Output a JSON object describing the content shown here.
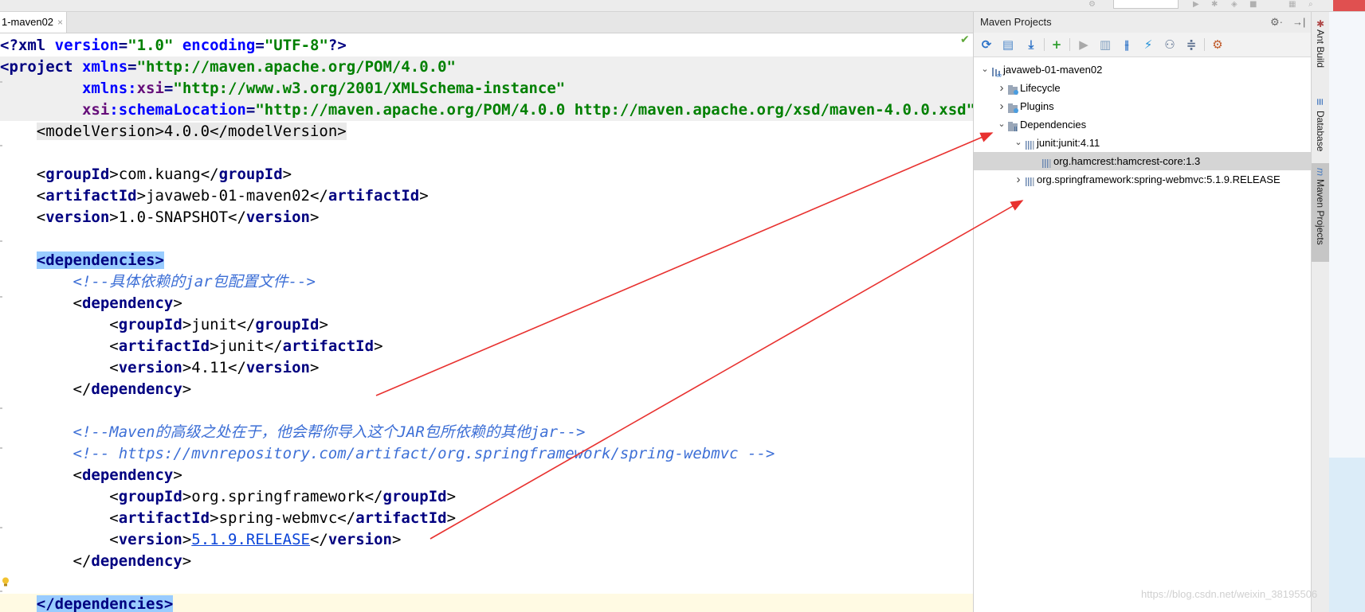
{
  "top_strip": {
    "icons": [
      "run-icon",
      "debug-icon",
      "profile-icon",
      "stop-icon",
      "layout-icon",
      "search-icon"
    ]
  },
  "editor": {
    "tab_label": "1-maven02",
    "tab_close": "×",
    "lines": [
      {
        "parts": [
          {
            "k": "t",
            "v": "<?"
          },
          {
            "k": "t",
            "v": "xml "
          },
          {
            "k": "a",
            "v": "version"
          },
          {
            "k": "t",
            "v": "="
          },
          {
            "k": "s",
            "v": "\"1.0\""
          },
          {
            "k": "t",
            "v": " "
          },
          {
            "k": "a",
            "v": "encoding"
          },
          {
            "k": "t",
            "v": "="
          },
          {
            "k": "s",
            "v": "\"UTF-8\""
          },
          {
            "k": "t",
            "v": "?>"
          }
        ]
      },
      {
        "hl": true,
        "parts": [
          {
            "k": "t",
            "v": "<project "
          },
          {
            "k": "a",
            "v": "xmlns"
          },
          {
            "k": "t",
            "v": "="
          },
          {
            "k": "s",
            "v": "\"http://maven.apache.org/POM/4.0.0\""
          }
        ]
      },
      {
        "hl": true,
        "parts": [
          {
            "k": "p",
            "v": "         "
          },
          {
            "k": "a",
            "v": "xmlns:"
          },
          {
            "k": "n",
            "v": "xsi"
          },
          {
            "k": "t",
            "v": "="
          },
          {
            "k": "s",
            "v": "\"http://www.w3.org/2001/XMLSchema-instance\""
          }
        ]
      },
      {
        "hl": true,
        "parts": [
          {
            "k": "p",
            "v": "         "
          },
          {
            "k": "n",
            "v": "xsi"
          },
          {
            "k": "a",
            "v": ":schemaLocation"
          },
          {
            "k": "t",
            "v": "="
          },
          {
            "k": "s",
            "v": "\"http://maven.apache.org/POM/4.0.0 http://maven.apache.org/xsd/maven-4.0.0.xsd\""
          }
        ]
      },
      {
        "parts": [
          {
            "k": "p",
            "v": "    "
          },
          {
            "k": "g",
            "v": "<modelVersion>4.0.0</modelVersion>"
          }
        ]
      },
      {
        "parts": []
      },
      {
        "parts": [
          {
            "k": "p",
            "v": "    "
          },
          {
            "k": "gt",
            "v": "<"
          },
          {
            "k": "tg",
            "v": "groupId"
          },
          {
            "k": "gt",
            "v": ">"
          },
          {
            "k": "p",
            "v": "com.kuang"
          },
          {
            "k": "gt",
            "v": "</"
          },
          {
            "k": "tg",
            "v": "groupId"
          },
          {
            "k": "gt",
            "v": ">"
          }
        ]
      },
      {
        "parts": [
          {
            "k": "p",
            "v": "    "
          },
          {
            "k": "gt",
            "v": "<"
          },
          {
            "k": "tg",
            "v": "artifactId"
          },
          {
            "k": "gt",
            "v": ">"
          },
          {
            "k": "p",
            "v": "javaweb-01-maven02"
          },
          {
            "k": "gt",
            "v": "</"
          },
          {
            "k": "tg",
            "v": "artifactId"
          },
          {
            "k": "gt",
            "v": ">"
          }
        ]
      },
      {
        "parts": [
          {
            "k": "p",
            "v": "    "
          },
          {
            "k": "gt",
            "v": "<"
          },
          {
            "k": "tg",
            "v": "version"
          },
          {
            "k": "gt",
            "v": ">"
          },
          {
            "k": "p",
            "v": "1.0-SNAPSHOT"
          },
          {
            "k": "gt",
            "v": "</"
          },
          {
            "k": "tg",
            "v": "version"
          },
          {
            "k": "gt",
            "v": ">"
          }
        ]
      },
      {
        "parts": []
      },
      {
        "parts": [
          {
            "k": "p",
            "v": "    "
          },
          {
            "k": "bm",
            "v": "<dependencies>"
          }
        ]
      },
      {
        "parts": [
          {
            "k": "p",
            "v": "        "
          },
          {
            "k": "c",
            "v": "<!--具体依赖的jar包配置文件-->"
          }
        ]
      },
      {
        "parts": [
          {
            "k": "p",
            "v": "        "
          },
          {
            "k": "gt",
            "v": "<"
          },
          {
            "k": "tg",
            "v": "dependency"
          },
          {
            "k": "gt",
            "v": ">"
          }
        ]
      },
      {
        "parts": [
          {
            "k": "p",
            "v": "            "
          },
          {
            "k": "gt",
            "v": "<"
          },
          {
            "k": "tg",
            "v": "groupId"
          },
          {
            "k": "gt",
            "v": ">"
          },
          {
            "k": "p",
            "v": "junit"
          },
          {
            "k": "gt",
            "v": "</"
          },
          {
            "k": "tg",
            "v": "groupId"
          },
          {
            "k": "gt",
            "v": ">"
          }
        ]
      },
      {
        "parts": [
          {
            "k": "p",
            "v": "            "
          },
          {
            "k": "gt",
            "v": "<"
          },
          {
            "k": "tg",
            "v": "artifactId"
          },
          {
            "k": "gt",
            "v": ">"
          },
          {
            "k": "p",
            "v": "junit"
          },
          {
            "k": "gt",
            "v": "</"
          },
          {
            "k": "tg",
            "v": "artifactId"
          },
          {
            "k": "gt",
            "v": ">"
          }
        ]
      },
      {
        "parts": [
          {
            "k": "p",
            "v": "            "
          },
          {
            "k": "gt",
            "v": "<"
          },
          {
            "k": "tg",
            "v": "version"
          },
          {
            "k": "gt",
            "v": ">"
          },
          {
            "k": "p",
            "v": "4.11"
          },
          {
            "k": "gt",
            "v": "</"
          },
          {
            "k": "tg",
            "v": "version"
          },
          {
            "k": "gt",
            "v": ">"
          }
        ]
      },
      {
        "parts": [
          {
            "k": "p",
            "v": "        "
          },
          {
            "k": "gt",
            "v": "</"
          },
          {
            "k": "tg",
            "v": "dependency"
          },
          {
            "k": "gt",
            "v": ">"
          }
        ]
      },
      {
        "parts": []
      },
      {
        "parts": [
          {
            "k": "p",
            "v": "        "
          },
          {
            "k": "c",
            "v": "<!--Maven的高级之处在于，他会帮你导入这个JAR包所依赖的其他jar-->"
          }
        ]
      },
      {
        "parts": [
          {
            "k": "p",
            "v": "        "
          },
          {
            "k": "c",
            "v": "<!-- https://mvnrepository.com/artifact/org.springframework/spring-webmvc -->"
          }
        ]
      },
      {
        "parts": [
          {
            "k": "p",
            "v": "        "
          },
          {
            "k": "gt",
            "v": "<"
          },
          {
            "k": "tg",
            "v": "dependency"
          },
          {
            "k": "gt",
            "v": ">"
          }
        ]
      },
      {
        "parts": [
          {
            "k": "p",
            "v": "            "
          },
          {
            "k": "gt",
            "v": "<"
          },
          {
            "k": "tg",
            "v": "groupId"
          },
          {
            "k": "gt",
            "v": ">"
          },
          {
            "k": "p",
            "v": "org.springframework"
          },
          {
            "k": "gt",
            "v": "</"
          },
          {
            "k": "tg",
            "v": "groupId"
          },
          {
            "k": "gt",
            "v": ">"
          }
        ]
      },
      {
        "parts": [
          {
            "k": "p",
            "v": "            "
          },
          {
            "k": "gt",
            "v": "<"
          },
          {
            "k": "tg",
            "v": "artifactId"
          },
          {
            "k": "gt",
            "v": ">"
          },
          {
            "k": "p",
            "v": "spring-webmvc"
          },
          {
            "k": "gt",
            "v": "</"
          },
          {
            "k": "tg",
            "v": "artifactId"
          },
          {
            "k": "gt",
            "v": ">"
          }
        ]
      },
      {
        "parts": [
          {
            "k": "p",
            "v": "            "
          },
          {
            "k": "gt",
            "v": "<"
          },
          {
            "k": "tg",
            "v": "version"
          },
          {
            "k": "gt",
            "v": ">"
          },
          {
            "k": "lnk",
            "v": "5.1.9.RELEASE"
          },
          {
            "k": "gt",
            "v": "</"
          },
          {
            "k": "tg",
            "v": "version"
          },
          {
            "k": "gt",
            "v": ">"
          }
        ]
      },
      {
        "parts": [
          {
            "k": "p",
            "v": "        "
          },
          {
            "k": "gt",
            "v": "</"
          },
          {
            "k": "tg",
            "v": "dependency"
          },
          {
            "k": "gt",
            "v": ">"
          }
        ]
      },
      {
        "parts": []
      },
      {
        "caret": true,
        "parts": [
          {
            "k": "p",
            "v": "    "
          },
          {
            "k": "bm",
            "v": "</dependencies>"
          }
        ]
      }
    ]
  },
  "maven": {
    "title": "Maven Projects",
    "settings": "⚙·",
    "hide": "→|",
    "toolbar": [
      "reimport-icon",
      "generate-sources-icon",
      "download-icon",
      "add-icon",
      "run-icon",
      "execute-goal-icon",
      "toggle-offline-icon",
      "skip-tests-icon",
      "show-dependencies-icon",
      "collapse-all-icon",
      "settings-icon"
    ],
    "tree": [
      {
        "label": "javaweb-01-maven02",
        "depth": 0,
        "expand": "open",
        "icon": "maven-module-icon"
      },
      {
        "label": "Lifecycle",
        "depth": 1,
        "expand": "closed",
        "icon": "folder-gear-icon"
      },
      {
        "label": "Plugins",
        "depth": 1,
        "expand": "closed",
        "icon": "folder-gear-icon"
      },
      {
        "label": "Dependencies",
        "depth": 1,
        "expand": "open",
        "icon": "folder-library-icon"
      },
      {
        "label": "junit:junit:4.11",
        "depth": 2,
        "expand": "open",
        "icon": "library-icon"
      },
      {
        "label": "org.hamcrest:hamcrest-core:1.3",
        "depth": 3,
        "expand": "none",
        "icon": "library-icon",
        "selected": true
      },
      {
        "label": "org.springframework:spring-webmvc:5.1.9.RELEASE",
        "depth": 2,
        "expand": "closed",
        "icon": "library-icon"
      }
    ]
  },
  "right_strip": {
    "tabs": [
      {
        "label": "Ant Build",
        "icon": "ant-icon"
      },
      {
        "label": "Database",
        "icon": "database-icon"
      },
      {
        "label": "Maven Projects",
        "icon": "maven-icon",
        "active": true
      }
    ]
  },
  "watermark": "https://blog.csdn.net/weixin_38195506",
  "colors": {
    "tag": "#000080",
    "attr": "#0000ff",
    "string": "#008000",
    "comment": "#3d6fd6",
    "arrow": "#e8312f",
    "selection": "#d5d5d5"
  }
}
